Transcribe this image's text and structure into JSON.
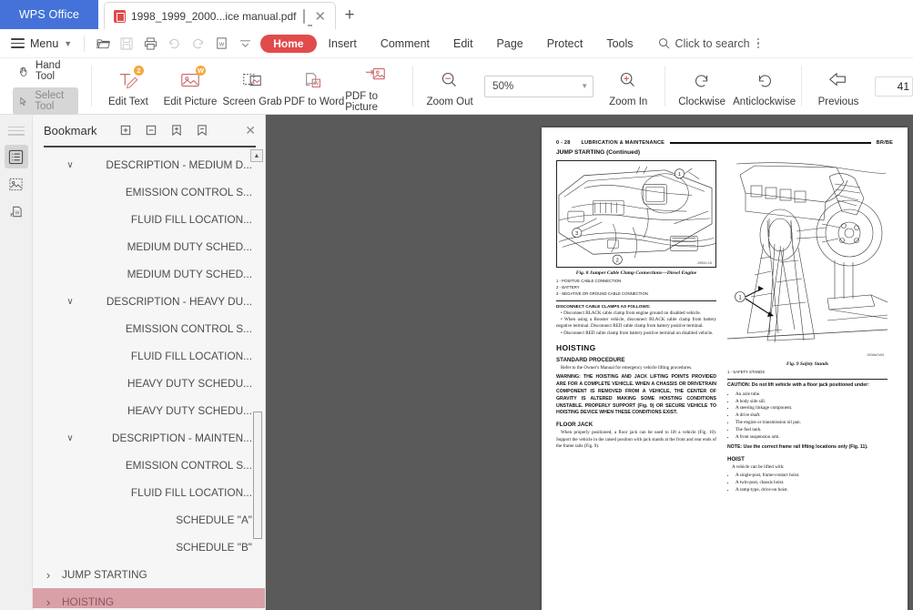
{
  "titlebar": {
    "app_name": "WPS Office",
    "tab": {
      "title": "1998_1999_2000...ice manual.pdf",
      "monitor_icon": "monitor-icon",
      "close_icon": "close-icon"
    },
    "new_tab_label": "+"
  },
  "menurow": {
    "menu_label": "Menu",
    "icons": [
      "open-folder-icon",
      "save-icon",
      "print-icon",
      "undo-icon",
      "redo-icon",
      "export-pdf-icon",
      "dropdown-icon"
    ],
    "items": [
      {
        "label": "Home",
        "active": true
      },
      {
        "label": "Insert",
        "active": false
      },
      {
        "label": "Comment",
        "active": false
      },
      {
        "label": "Edit",
        "active": false
      },
      {
        "label": "Page",
        "active": false
      },
      {
        "label": "Protect",
        "active": false
      },
      {
        "label": "Tools",
        "active": false
      }
    ],
    "search_placeholder": "Click to search",
    "accent_color": "#e24b4b"
  },
  "ribbon": {
    "hand_tool": "Hand Tool",
    "select_tool": "Select Tool",
    "buttons": [
      {
        "label": "Edit Text",
        "icon": "edit-text-icon",
        "badge": "2"
      },
      {
        "label": "Edit Picture",
        "icon": "edit-picture-icon",
        "badge": "W"
      },
      {
        "label": "Screen Grab",
        "icon": "screen-grab-icon",
        "badge": ""
      },
      {
        "label": "PDF to Word",
        "icon": "pdf-to-word-icon",
        "badge": ""
      },
      {
        "label": "PDF to Picture",
        "icon": "pdf-to-picture-icon",
        "badge": ""
      }
    ],
    "zoom_out": "Zoom Out",
    "zoom_value": "50%",
    "zoom_in": "Zoom In",
    "clockwise": "Clockwise",
    "anticlockwise": "Anticlockwise",
    "previous": "Previous",
    "page_number": "41"
  },
  "rail": {
    "items": [
      {
        "name": "bookmark-panel-icon",
        "active": true
      },
      {
        "name": "thumbnail-panel-icon",
        "active": false
      },
      {
        "name": "attachment-panel-icon",
        "active": false
      }
    ]
  },
  "bookmark": {
    "title": "Bookmark",
    "toolbar_icons": [
      "expand-all-icon",
      "collapse-all-icon",
      "add-bookmark-icon",
      "remove-bookmark-icon"
    ],
    "close_icon": "close-icon",
    "items": [
      {
        "label": "DESCRIPTION - MEDIUM D...",
        "level": 1,
        "chevron": "down",
        "selected": false
      },
      {
        "label": "EMISSION CONTROL S...",
        "level": 2,
        "chevron": "",
        "selected": false
      },
      {
        "label": "FLUID FILL LOCATION...",
        "level": 2,
        "chevron": "",
        "selected": false
      },
      {
        "label": "MEDIUM DUTY SCHED...",
        "level": 2,
        "chevron": "",
        "selected": false
      },
      {
        "label": "MEDIUM DUTY SCHED...",
        "level": 2,
        "chevron": "",
        "selected": false
      },
      {
        "label": "DESCRIPTION - HEAVY DU...",
        "level": 1,
        "chevron": "down",
        "selected": false
      },
      {
        "label": "EMISSION CONTROL S...",
        "level": 2,
        "chevron": "",
        "selected": false
      },
      {
        "label": "FLUID FILL LOCATION...",
        "level": 2,
        "chevron": "",
        "selected": false
      },
      {
        "label": "HEAVY DUTY SCHEDU...",
        "level": 2,
        "chevron": "",
        "selected": false
      },
      {
        "label": "HEAVY DUTY SCHEDU...",
        "level": 2,
        "chevron": "",
        "selected": false
      },
      {
        "label": "DESCRIPTION - MAINTEN...",
        "level": 1,
        "chevron": "down",
        "selected": false
      },
      {
        "label": "EMISSION CONTROL S...",
        "level": 2,
        "chevron": "",
        "selected": false
      },
      {
        "label": "FLUID FILL LOCATION...",
        "level": 2,
        "chevron": "",
        "selected": false
      },
      {
        "label": "SCHEDULE \"A\"",
        "level": 2,
        "chevron": "",
        "selected": false
      },
      {
        "label": "SCHEDULE \"B\"",
        "level": 2,
        "chevron": "",
        "selected": false
      },
      {
        "label": "JUMP STARTING",
        "level": 0,
        "chevron": "right",
        "selected": false
      },
      {
        "label": "HOISTING",
        "level": 0,
        "chevron": "right",
        "selected": true
      }
    ],
    "selected_color": "#d9a0a8"
  },
  "document": {
    "header_page": "0 - 28",
    "header_section": "LUBRICATION & MAINTENANCE",
    "header_right": "BR/BE",
    "subheader": "JUMP STARTING (Continued)",
    "fig8": {
      "caption": "Fig. 8 Jumper Cable Clamp Connections—Diesel Engine",
      "signature": "J9500-15",
      "callouts": [
        "1",
        "2",
        "3"
      ],
      "legend": [
        "1 - POSITIVE CABLE CONNECTION",
        "2 - BATTERY",
        "3 - NEGATIVE OR GROUND CABLE CONNECTION"
      ]
    },
    "fig9": {
      "caption": "Fig. 9 Safety Stands",
      "signature": "J908a7x94",
      "callouts": [
        "1"
      ],
      "legend": [
        "1 - SAFETY STANDS"
      ]
    },
    "left_column": {
      "disconnect_heading": "DISCONNECT CABLE CLAMPS AS FOLLOWS:",
      "disconnect_bullets": [
        "Disconnect BLACK cable clamp from engine ground on disabled vehicle.",
        "When using a Booster vehicle, disconnect BLACK cable clamp from battery negative terminal. Disconnect RED cable clamp from battery positive terminal.",
        "Disconnect RED cable clamp from battery positive terminal on disabled vehicle."
      ],
      "hoisting_heading": "HOISTING",
      "standard_procedure_heading": "STANDARD PROCEDURE",
      "standard_procedure_body": "Refer to the Owner's Manual for emergency vehicle lifting procedures.",
      "warning": "WARNING: THE HOISTING AND JACK LIFTING POINTS PROVIDED ARE FOR A COMPLETE VEHICLE. WHEN A CHASSIS OR DRIVETRAIN COMPONENT IS REMOVED FROM A VEHICLE, THE CENTER OF GRAVITY IS ALTERED MAKING SOME HOISTING CONDITIONS UNSTABLE. PROPERLY SUPPORT (Fig. 9) OR SECURE VEHICLE TO HOISTING DEVICE WHEN THESE CONDITIONS EXIST.",
      "floor_jack_heading": "FLOOR JACK",
      "floor_jack_body": "When properly positioned, a floor jack can be used to lift a vehicle (Fig. 10). Support the vehicle in the raised position with jack stands at the front and rear ends of the frame rails (Fig. 9)."
    },
    "right_column": {
      "caution": "CAUTION: Do not lift vehicle with a floor jack positioned under:",
      "caution_bullets": [
        "An axle tube.",
        "A body side sill.",
        "A steering linkage component.",
        "A drive shaft.",
        "The engine or transmission oil pan.",
        "The fuel tank.",
        "A front suspension arm."
      ],
      "note": "NOTE: Use the correct frame rail lifting locations only (Fig. 11).",
      "hoist_heading": "HOIST",
      "hoist_intro": "A vehicle can be lifted with:",
      "hoist_bullets": [
        "A single-post, frame-contact hoist.",
        "A twin-post, chassis hoist.",
        "A ramp-type, drive-on hoist."
      ]
    }
  }
}
